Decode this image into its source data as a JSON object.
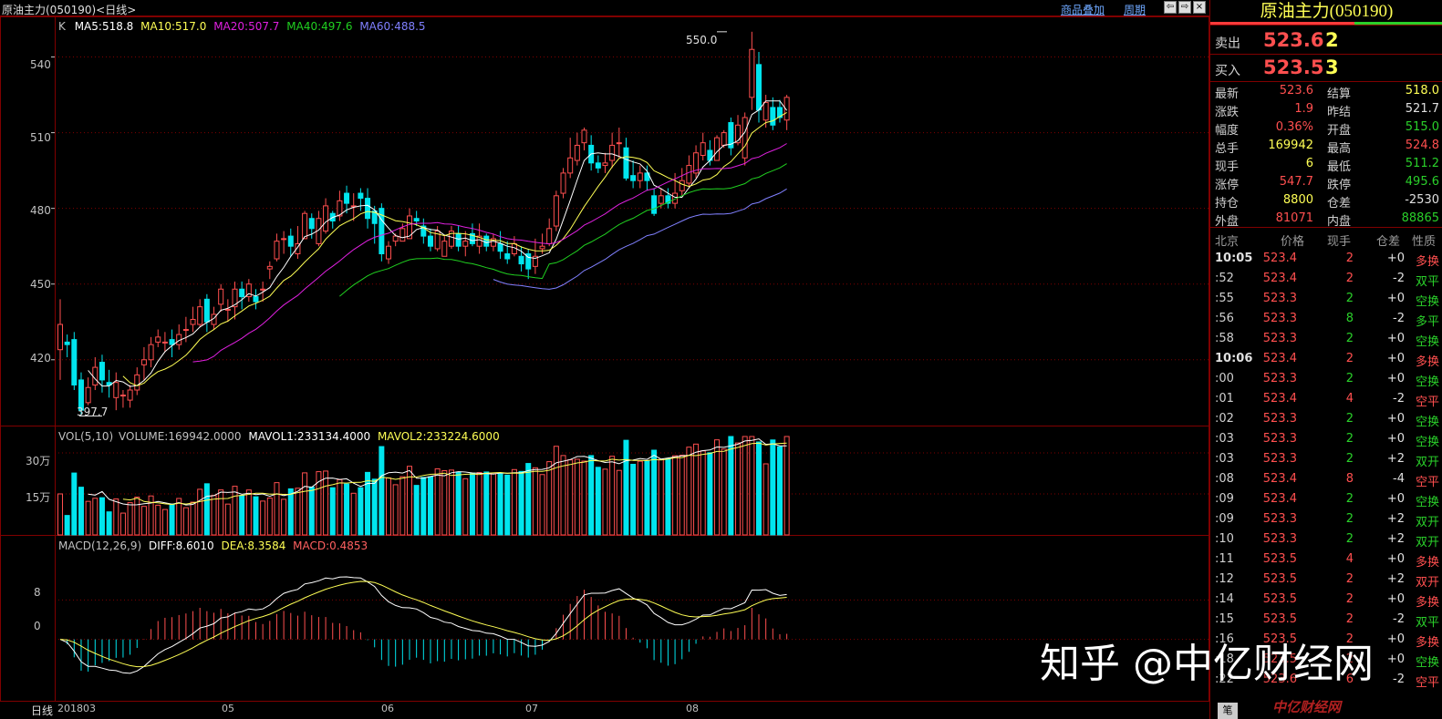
{
  "window": {
    "title": "原油主力(050190)<日线>",
    "menu": [
      "商品叠加",
      "周期"
    ]
  },
  "main_panel": {
    "indicator": {
      "prefix": "K",
      "ma5": "MA5:518.8",
      "ma10": "MA10:517.0",
      "ma20": "MA20:507.7",
      "ma40": "MA40:497.6",
      "ma60": "MA60:488.5"
    },
    "y_ticks": [
      "540",
      "510",
      "480",
      "450",
      "420"
    ],
    "high_label": "550.0",
    "low_label": "397.7"
  },
  "volume_panel": {
    "indicator": {
      "prefix": "VOL(5,10)",
      "volume": "VOLUME:169942.0000",
      "mavol1": "MAVOL1:233134.4000",
      "mavol2": "MAVOL2:233224.6000"
    },
    "y_ticks": [
      "30万",
      "15万"
    ]
  },
  "macd_panel": {
    "indicator": {
      "prefix": "MACD(12,26,9)",
      "diff": "DIFF:8.6010",
      "dea": "DEA:8.3584",
      "macd": "MACD:0.4853"
    },
    "y_ticks": [
      "8",
      "0"
    ]
  },
  "x_axis": {
    "period_label": "日线",
    "labels": [
      "201803",
      "05",
      "06",
      "07",
      "08"
    ]
  },
  "quote": {
    "title": "原油主力(050190)",
    "ask": {
      "label": "卖出",
      "price": "523.6",
      "qty": "2"
    },
    "bid": {
      "label": "买入",
      "price": "523.5",
      "qty": "3"
    },
    "stats": [
      {
        "k1": "最新",
        "v1": "523.6",
        "c1": "#ff4f4f",
        "k2": "结算",
        "v2": "518.0",
        "c2": "#ffff55"
      },
      {
        "k1": "涨跌",
        "v1": "1.9",
        "c1": "#ff4f4f",
        "k2": "昨结",
        "v2": "521.7",
        "c2": "#e0e0e0"
      },
      {
        "k1": "幅度",
        "v1": "0.36%",
        "c1": "#ff4f4f",
        "k2": "开盘",
        "v2": "515.0",
        "c2": "#2ad02a"
      },
      {
        "k1": "总手",
        "v1": "169942",
        "c1": "#ffff55",
        "k2": "最高",
        "v2": "524.8",
        "c2": "#ff4f4f"
      },
      {
        "k1": "现手",
        "v1": "6",
        "c1": "#ffff55",
        "k2": "最低",
        "v2": "511.2",
        "c2": "#2ad02a"
      },
      {
        "k1": "涨停",
        "v1": "547.7",
        "c1": "#ff4f4f",
        "k2": "跌停",
        "v2": "495.6",
        "c2": "#2ad02a"
      },
      {
        "k1": "持仓",
        "v1": "8800",
        "c1": "#ffff55",
        "k2": "仓差",
        "v2": "-2530",
        "c2": "#e0e0e0"
      },
      {
        "k1": "外盘",
        "v1": "81071",
        "c1": "#ff4f4f",
        "k2": "内盘",
        "v2": "88865",
        "c2": "#2ad02a"
      }
    ],
    "ticks_header": [
      "北京",
      "价格",
      "现手",
      "仓差",
      "性质"
    ],
    "ticks": [
      {
        "t": "10:05",
        "p": "523.4",
        "v": "2",
        "oi": "+0",
        "n": "多换",
        "nc": "#ff4f4f",
        "vc": "#ff4f4f"
      },
      {
        "t": ":52",
        "p": "523.4",
        "v": "2",
        "oi": "-2",
        "n": "双平",
        "nc": "#2ad02a",
        "vc": "#ff4f4f"
      },
      {
        "t": ":55",
        "p": "523.3",
        "v": "2",
        "oi": "+0",
        "n": "空换",
        "nc": "#2ad02a",
        "vc": "#2ad02a"
      },
      {
        "t": ":56",
        "p": "523.3",
        "v": "8",
        "oi": "-2",
        "n": "多平",
        "nc": "#2ad02a",
        "vc": "#2ad02a"
      },
      {
        "t": ":58",
        "p": "523.3",
        "v": "2",
        "oi": "+0",
        "n": "空换",
        "nc": "#2ad02a",
        "vc": "#2ad02a"
      },
      {
        "t": "10:06",
        "p": "523.4",
        "v": "2",
        "oi": "+0",
        "n": "多换",
        "nc": "#ff4f4f",
        "vc": "#ff4f4f"
      },
      {
        "t": ":00",
        "p": "523.3",
        "v": "2",
        "oi": "+0",
        "n": "空换",
        "nc": "#2ad02a",
        "vc": "#2ad02a"
      },
      {
        "t": ":01",
        "p": "523.4",
        "v": "4",
        "oi": "-2",
        "n": "空平",
        "nc": "#ff4f4f",
        "vc": "#ff4f4f"
      },
      {
        "t": ":02",
        "p": "523.3",
        "v": "2",
        "oi": "+0",
        "n": "空换",
        "nc": "#2ad02a",
        "vc": "#2ad02a"
      },
      {
        "t": ":03",
        "p": "523.3",
        "v": "2",
        "oi": "+0",
        "n": "空换",
        "nc": "#2ad02a",
        "vc": "#2ad02a"
      },
      {
        "t": ":03",
        "p": "523.3",
        "v": "2",
        "oi": "+2",
        "n": "双开",
        "nc": "#2ad02a",
        "vc": "#2ad02a"
      },
      {
        "t": ":08",
        "p": "523.4",
        "v": "8",
        "oi": "-4",
        "n": "空平",
        "nc": "#ff4f4f",
        "vc": "#ff4f4f"
      },
      {
        "t": ":09",
        "p": "523.4",
        "v": "2",
        "oi": "+0",
        "n": "空换",
        "nc": "#2ad02a",
        "vc": "#2ad02a"
      },
      {
        "t": ":09",
        "p": "523.3",
        "v": "2",
        "oi": "+2",
        "n": "双开",
        "nc": "#2ad02a",
        "vc": "#2ad02a"
      },
      {
        "t": ":10",
        "p": "523.3",
        "v": "2",
        "oi": "+2",
        "n": "双开",
        "nc": "#2ad02a",
        "vc": "#2ad02a"
      },
      {
        "t": ":11",
        "p": "523.5",
        "v": "4",
        "oi": "+0",
        "n": "多换",
        "nc": "#ff4f4f",
        "vc": "#ff4f4f"
      },
      {
        "t": ":12",
        "p": "523.5",
        "v": "2",
        "oi": "+2",
        "n": "双开",
        "nc": "#ff4f4f",
        "vc": "#ff4f4f"
      },
      {
        "t": ":14",
        "p": "523.5",
        "v": "2",
        "oi": "+0",
        "n": "多换",
        "nc": "#ff4f4f",
        "vc": "#ff4f4f"
      },
      {
        "t": ":15",
        "p": "523.5",
        "v": "2",
        "oi": "-2",
        "n": "双平",
        "nc": "#2ad02a",
        "vc": "#ff4f4f"
      },
      {
        "t": ":16",
        "p": "523.5",
        "v": "2",
        "oi": "+0",
        "n": "多换",
        "nc": "#ff4f4f",
        "vc": "#ff4f4f"
      },
      {
        "t": ":18",
        "p": "523.5",
        "v": "2",
        "oi": "+0",
        "n": "空换",
        "nc": "#2ad02a",
        "vc": "#ff4f4f"
      },
      {
        "t": ":22",
        "p": "523.6",
        "v": "6",
        "oi": "-2",
        "n": "空平",
        "nc": "#ff4f4f",
        "vc": "#ff4f4f"
      }
    ],
    "bottom_tab": "笔"
  },
  "watermark": {
    "text": "知乎 @中亿财经网",
    "sub": "中亿财经网"
  },
  "colors": {
    "up": "#ff4f4f",
    "down": "#00e5ee",
    "ma5": "#ffffff",
    "ma10": "#ffff55",
    "ma20": "#e020e0",
    "ma40": "#20d020",
    "ma60": "#8080ff",
    "grid": "#800000"
  },
  "chart_data": {
    "type": "candlestick",
    "series_note": "daily bars, x index 0..100",
    "candles": [
      [
        424,
        434,
        412,
        444
      ],
      [
        427,
        426,
        421,
        430
      ],
      [
        428,
        410,
        408,
        431
      ],
      [
        412,
        400,
        398,
        415
      ],
      [
        403,
        409,
        402,
        413
      ],
      [
        410,
        417,
        408,
        421
      ],
      [
        419,
        412,
        407,
        422
      ],
      [
        411,
        410,
        405,
        416
      ],
      [
        405,
        411,
        400,
        415
      ],
      [
        406,
        406,
        401,
        408
      ],
      [
        404,
        408,
        401,
        410
      ],
      [
        408,
        414,
        406,
        417
      ],
      [
        418,
        420,
        412,
        425
      ],
      [
        420,
        426,
        417,
        429
      ],
      [
        427,
        429,
        425,
        432
      ],
      [
        427,
        427,
        423,
        431
      ],
      [
        428,
        426,
        421,
        432
      ],
      [
        426,
        430,
        424,
        434
      ],
      [
        432,
        432,
        427,
        437
      ],
      [
        434,
        436,
        431,
        441
      ],
      [
        434,
        441,
        433,
        444
      ],
      [
        444,
        435,
        431,
        446
      ],
      [
        434,
        438,
        432,
        441
      ],
      [
        442,
        448,
        439,
        450
      ],
      [
        440,
        440,
        435,
        444
      ],
      [
        441,
        448,
        436,
        451
      ],
      [
        448,
        445,
        440,
        451
      ],
      [
        445,
        450,
        443,
        452
      ],
      [
        445,
        443,
        440,
        448
      ],
      [
        448,
        448,
        443,
        451
      ],
      [
        456,
        457,
        452,
        459
      ],
      [
        460,
        467,
        459,
        470
      ],
      [
        468,
        468,
        462,
        471
      ],
      [
        469,
        465,
        461,
        472
      ],
      [
        462,
        466,
        460,
        473
      ],
      [
        468,
        478,
        468,
        479
      ],
      [
        476,
        472,
        468,
        478
      ],
      [
        466,
        476,
        465,
        479
      ],
      [
        471,
        481,
        470,
        484
      ],
      [
        478,
        475,
        472,
        479
      ],
      [
        477,
        483,
        475,
        487
      ],
      [
        486,
        482,
        478,
        489
      ],
      [
        481,
        481,
        475,
        486
      ],
      [
        486,
        484,
        479,
        488
      ],
      [
        484,
        476,
        472,
        488
      ],
      [
        479,
        474,
        466,
        481
      ],
      [
        480,
        462,
        459,
        482
      ],
      [
        460,
        465,
        458,
        467
      ],
      [
        467,
        469,
        465,
        470
      ],
      [
        467,
        472,
        468,
        474
      ],
      [
        468,
        477,
        472,
        480
      ],
      [
        476,
        475,
        473,
        479
      ],
      [
        473,
        469,
        466,
        476
      ],
      [
        469,
        465,
        463,
        472
      ],
      [
        464,
        471,
        463,
        473
      ],
      [
        461,
        467,
        463,
        469
      ],
      [
        465,
        471,
        464,
        473
      ],
      [
        470,
        465,
        463,
        473
      ],
      [
        465,
        467,
        461,
        471
      ],
      [
        470,
        466,
        465,
        474
      ],
      [
        465,
        469,
        462,
        474
      ],
      [
        469,
        465,
        463,
        470
      ],
      [
        465,
        468,
        463,
        470
      ],
      [
        466,
        463,
        460,
        471
      ],
      [
        462,
        460,
        458,
        467
      ],
      [
        462,
        466,
        461,
        469
      ],
      [
        461,
        458,
        455,
        465
      ],
      [
        462,
        456,
        452,
        464
      ],
      [
        457,
        461,
        454,
        468
      ],
      [
        464,
        465,
        462,
        470
      ],
      [
        466,
        472,
        465,
        476
      ],
      [
        473,
        485,
        471,
        487
      ],
      [
        486,
        494,
        484,
        496
      ],
      [
        494,
        500,
        492,
        508
      ],
      [
        499,
        505,
        497,
        510
      ],
      [
        506,
        511,
        503,
        512
      ],
      [
        505,
        498,
        495,
        509
      ],
      [
        498,
        496,
        494,
        501
      ],
      [
        497,
        498,
        494,
        502
      ],
      [
        499,
        505,
        496,
        510
      ],
      [
        506,
        506,
        500,
        512
      ],
      [
        504,
        492,
        491,
        508
      ],
      [
        493,
        491,
        488,
        499
      ],
      [
        491,
        494,
        488,
        497
      ],
      [
        494,
        491,
        487,
        497
      ],
      [
        485,
        478,
        477,
        488
      ],
      [
        482,
        485,
        480,
        488
      ],
      [
        485,
        482,
        480,
        488
      ],
      [
        482,
        486,
        480,
        494
      ],
      [
        487,
        491,
        485,
        496
      ],
      [
        490,
        497,
        488,
        501
      ],
      [
        494,
        502,
        492,
        505
      ],
      [
        501,
        506,
        499,
        510
      ],
      [
        503,
        499,
        497,
        507
      ],
      [
        499,
        508,
        499,
        509
      ],
      [
        505,
        510,
        504,
        511
      ],
      [
        514,
        504,
        501,
        516
      ],
      [
        506,
        513,
        505,
        517
      ],
      [
        500,
        516,
        497,
        518
      ],
      [
        524,
        543,
        519,
        550
      ],
      [
        537,
        519,
        514,
        542
      ],
      [
        515,
        522,
        512,
        525
      ],
      [
        520,
        513,
        511,
        524
      ],
      [
        520,
        516,
        514,
        523
      ],
      [
        515,
        524,
        511,
        525
      ]
    ],
    "ma_ylim": [
      395,
      555
    ],
    "volume_ylim": [
      0,
      400000
    ],
    "macd_ylim": [
      -11,
      19
    ]
  }
}
